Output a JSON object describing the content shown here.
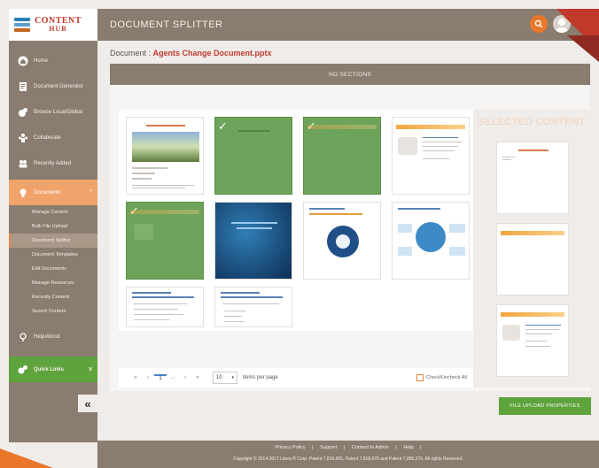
{
  "logo": {
    "line1": "CONTENT",
    "line2": "HUB"
  },
  "header": {
    "title": "DOCUMENT SPLITTER"
  },
  "sidebar": {
    "items": [
      {
        "label": "Home",
        "icon": "home-icon"
      },
      {
        "label": "Document Generator",
        "icon": "document-icon"
      },
      {
        "label": "Browse Local/Global",
        "icon": "globe-icon"
      },
      {
        "label": "Collaborate",
        "icon": "people-icon"
      },
      {
        "label": "Recently Added",
        "icon": "group-icon"
      }
    ],
    "active": {
      "label": "Documents",
      "icon": "lightbulb-icon"
    },
    "subitems": [
      "Manage Content",
      "Bulk File Upload",
      "Document Splitter",
      "Document Templates",
      "Edit Documents",
      "Manage Resources",
      "Recently Content",
      "Search Content"
    ],
    "help": {
      "label": "Help/About",
      "icon": "help-icon"
    },
    "quick": {
      "label": "Quick Links",
      "icon": "links-icon"
    },
    "collapse": "«"
  },
  "document": {
    "prefix": "Document :",
    "name": "Agents Change Document.pptx"
  },
  "sections_label": "NO SECTIONS",
  "selected_title": "SELECTED CONTENT",
  "pager": {
    "first": "«",
    "prev": "‹",
    "current": "1",
    "ellipsis": "...",
    "next": "›",
    "last": "»",
    "per_page_value": "10",
    "per_page_label": "items per page",
    "check_all": "Check/Uncheck All"
  },
  "upload_button": "FILE UPLOAD PROPERTIES",
  "footer": {
    "links": [
      "Privacy Policy",
      "|",
      "Support",
      "|",
      "Contact to Admin",
      "|",
      "Help",
      "|"
    ],
    "copyright": "Copyright © 2014-2017 Litera ® Corp. Patent 7,818,665, Patent 7,818,678 and Patent 7,895,276. All rights Reserved."
  },
  "colors": {
    "brand": "#8a7c6e",
    "accent": "#e8772a",
    "active": "#f0a36a",
    "green": "#5ea33c",
    "title_red": "#c0392b"
  }
}
